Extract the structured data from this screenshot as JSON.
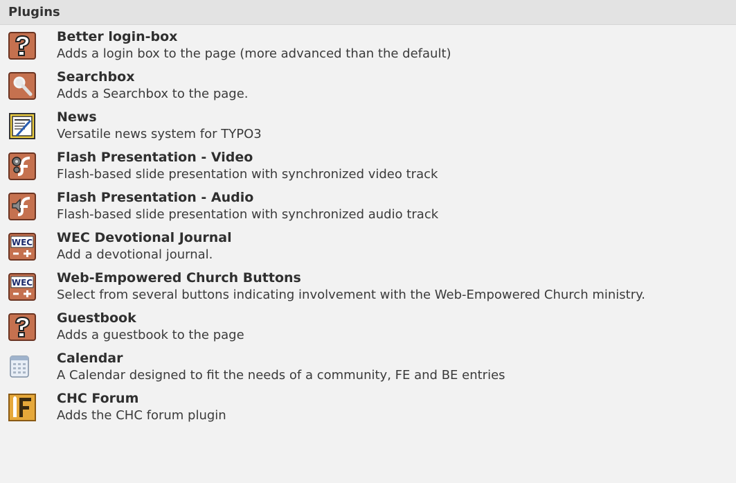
{
  "header": {
    "title": "Plugins"
  },
  "plugins": [
    {
      "title": "Better login-box",
      "description": "Adds a login box to the page (more advanced than the default)",
      "icon": "question-icon"
    },
    {
      "title": "Searchbox",
      "description": "Adds a Searchbox to the page.",
      "icon": "magnifier-icon"
    },
    {
      "title": "News",
      "description": "Versatile news system for TYPO3",
      "icon": "news-icon"
    },
    {
      "title": "Flash Presentation - Video",
      "description": "Flash-based slide presentation with synchronized video track",
      "icon": "flash-video-icon"
    },
    {
      "title": "Flash Presentation - Audio",
      "description": "Flash-based slide presentation with synchronized audio track",
      "icon": "flash-audio-icon"
    },
    {
      "title": "WEC Devotional Journal",
      "description": "Add a devotional journal.",
      "icon": "wec-icon"
    },
    {
      "title": "Web-Empowered Church Buttons",
      "description": "Select from several buttons indicating involvement with the Web-Empowered Church ministry.",
      "icon": "wec-icon"
    },
    {
      "title": "Guestbook",
      "description": "Adds a guestbook to the page",
      "icon": "question-icon"
    },
    {
      "title": "Calendar",
      "description": "A Calendar designed to fit the needs of a community, FE and BE entries",
      "icon": "calendar-icon"
    },
    {
      "title": "CHC Forum",
      "description": "Adds the CHC forum plugin",
      "icon": "forum-icon"
    }
  ],
  "colors": {
    "icon_brown": "#c5714f",
    "header_bg": "#e3e3e3",
    "panel_bg": "#f2f2f2"
  }
}
